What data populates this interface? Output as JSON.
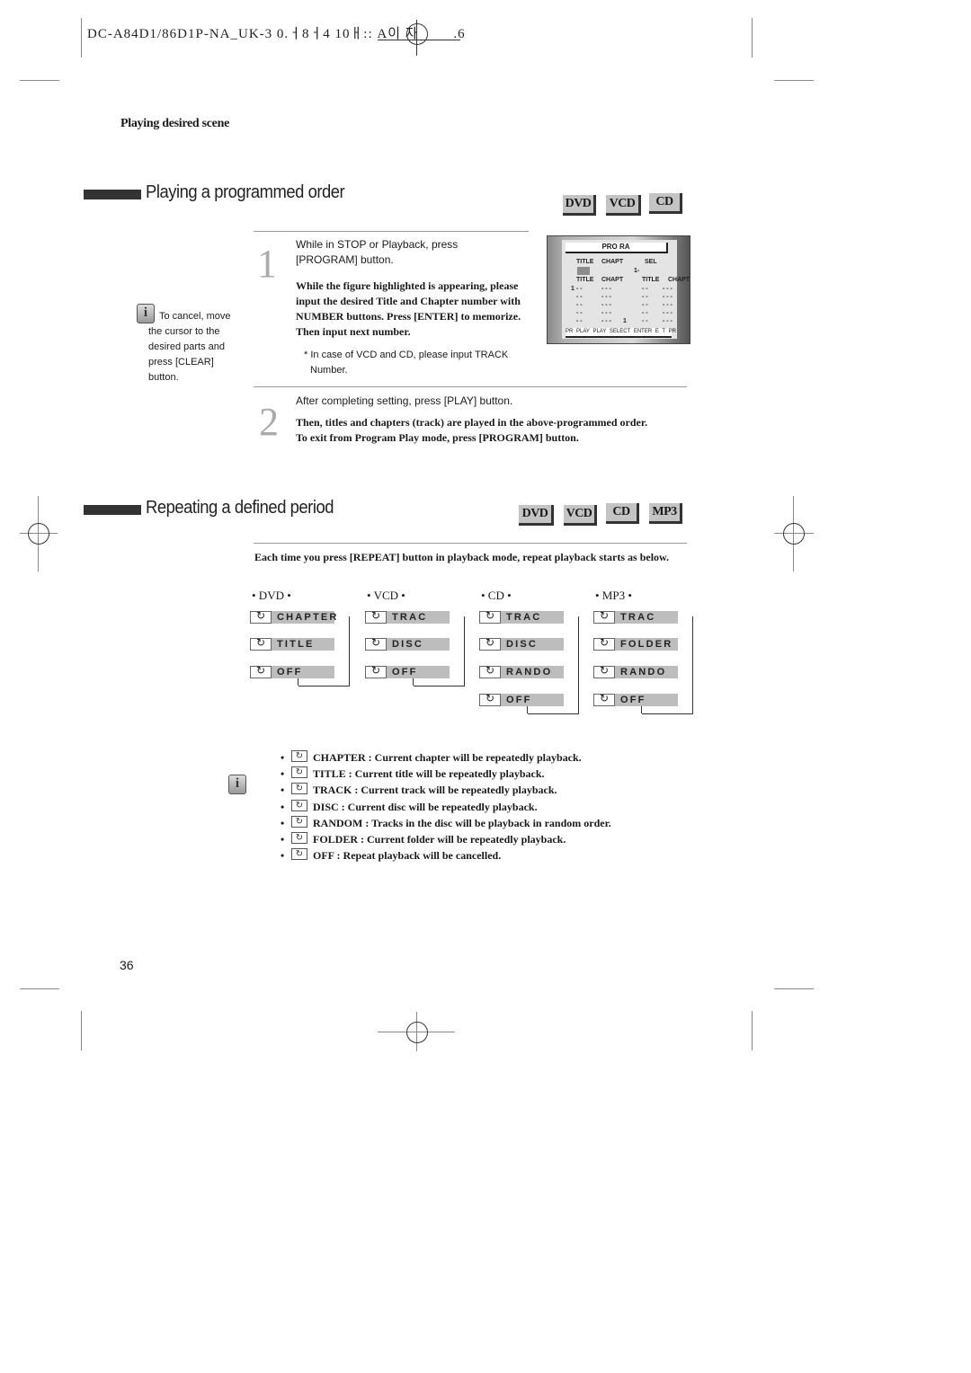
{
  "header": {
    "doc_code": "DC-A84D1/86D1P-NA_UK-3  0.ㅓ8ㅓ4  10ㅐ:: A이 자",
    "suffix": ".6"
  },
  "subtitle": "Playing desired scene",
  "section1": {
    "title": "Playing a programmed order",
    "badges": [
      "DVD",
      "VCD",
      "CD"
    ],
    "step1": {
      "number": "1",
      "line1": "While in STOP or Playback, press",
      "line2": "[PROGRAM] button.",
      "bold_lines": [
        "While the figure highlighted is appearing, please",
        "input the desired Title and Chapter number with",
        "NUMBER buttons. Press [ENTER] to memorize.",
        "Then input next number."
      ],
      "note_line1": "* In case of VCD and CD, please input TRACK",
      "note_line2": "Number."
    },
    "tip": {
      "icon": "info-icon",
      "lines": [
        "To cancel, move",
        "the cursor to the",
        "desired parts  and",
        "press [CLEAR]",
        "button."
      ]
    },
    "osd": {
      "title": "PRO   RA",
      "hdr_title": "TITLE",
      "hdr_chapt": "CHAPT",
      "hdr_sel": "SEL",
      "sel_value": "1-",
      "col_title": "TITLE",
      "col_chapt": "CHAPT",
      "col_title2": "TITLE",
      "col_chapt2": "CHAPT",
      "row_index": "1",
      "dash2": "- -",
      "dash3": "- - -",
      "page_num": "1",
      "footer": "PR  PLAY  PLAY  SELECT  ENTER  E   T  PR"
    },
    "step2": {
      "number": "2",
      "line1": "After completing setting, press [PLAY] button.",
      "bold1": "Then, titles and chapters (track) are played in the above-programmed order.",
      "bold2": "To exit from Program Play mode, press [PROGRAM] button."
    }
  },
  "section2": {
    "title": "Repeating a defined period",
    "badges": [
      "DVD",
      "VCD",
      "CD",
      "MP3"
    ],
    "intro": "Each time you press [REPEAT] button in playback mode, repeat playback starts as below.",
    "columns": [
      {
        "head": "• DVD •",
        "items": [
          "CHAPTER",
          "TITLE",
          "OFF"
        ]
      },
      {
        "head": "• VCD •",
        "items": [
          "TRAC",
          "DISC",
          "OFF"
        ]
      },
      {
        "head": "• CD •",
        "items": [
          "TRAC",
          "DISC",
          "RANDO",
          "OFF"
        ]
      },
      {
        "head": "• MP3 •",
        "items": [
          "TRAC",
          "FOLDER",
          "RANDO",
          "OFF"
        ]
      }
    ],
    "legend": [
      "CHAPTER : Current chapter will be repeatedly playback.",
      "TITLE : Current title will be repeatedly playback.",
      "TRACK : Current track will be repeatedly playback.",
      "DISC : Current disc will be repeatedly playback.",
      "RANDOM : Tracks in the disc will be playback in random order.",
      "FOLDER : Current folder will be repeatedly playback.",
      "OFF : Repeat playback will be cancelled."
    ],
    "legend_bullet": "•"
  },
  "page_number": "36"
}
